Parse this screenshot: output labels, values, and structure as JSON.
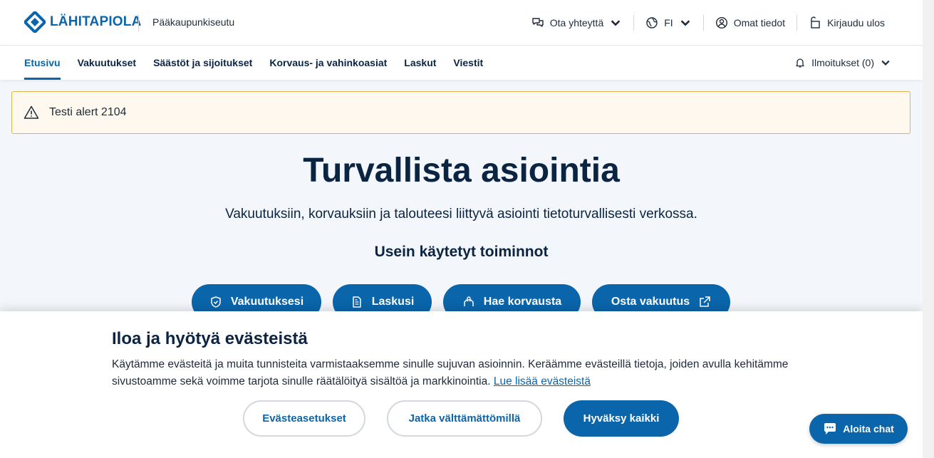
{
  "header": {
    "logo_text": "LÄHITAPIOLA",
    "region": "Pääkaupunkiseutu",
    "contact_label": "Ota yhteyttä",
    "language_label": "FI",
    "profile_label": "Omat tiedot",
    "logout_label": "Kirjaudu ulos"
  },
  "nav": {
    "items": [
      {
        "label": "Etusivu"
      },
      {
        "label": "Vakuutukset"
      },
      {
        "label": "Säästöt ja sijoitukset"
      },
      {
        "label": "Korvaus- ja vahinkoasiat"
      },
      {
        "label": "Laskut"
      },
      {
        "label": "Viestit"
      }
    ],
    "notifications_label": "Ilmoitukset (0)"
  },
  "alert": {
    "text": "Testi alert 2104"
  },
  "hero": {
    "title": "Turvallista asiointia",
    "subtitle": "Vakuutuksiin, korvauksiin ja talouteesi liittyvä asiointi tietoturvallisesti verkossa.",
    "quick_title": "Usein käytetyt toiminnot",
    "quick_actions": [
      {
        "label": "Vakuutuksesi",
        "icon": "shield-icon"
      },
      {
        "label": "Laskusi",
        "icon": "document-icon"
      },
      {
        "label": "Hae korvausta",
        "icon": "hands-icon"
      },
      {
        "label": "Osta vakuutus",
        "icon": "external-link-icon"
      }
    ]
  },
  "cookie": {
    "title": "Iloa ja hyötyä evästeistä",
    "text": "Käytämme evästeitä ja muita tunnisteita varmistaaksemme sinulle sujuvan asioinnin. Keräämme evästeillä tietoja, joiden avulla kehitämme sivustoamme sekä voimme tarjota sinulle räätälöityä sisältöä ja markkinointia.",
    "link": "Lue lisää evästeistä",
    "settings_label": "Evästeasetukset",
    "necessary_label": "Jatka välttämättömillä",
    "accept_label": "Hyväksy kaikki"
  },
  "chat": {
    "label": "Aloita chat"
  },
  "colors": {
    "brand": "#0a65aa",
    "navy": "#0b2442",
    "alert_border": "#e0b34c",
    "alert_bg": "#fff8ee"
  }
}
